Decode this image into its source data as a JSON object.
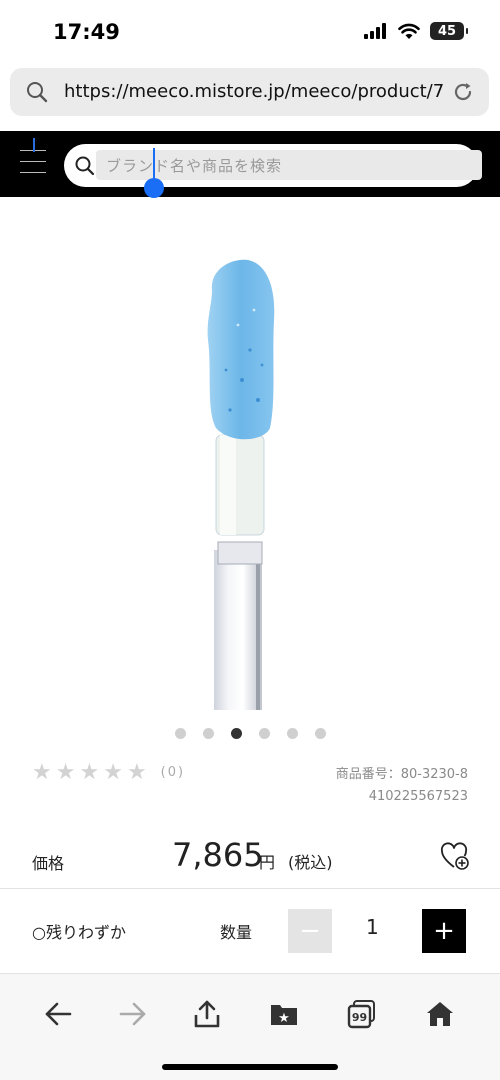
{
  "status_bar": {
    "time": "17:49",
    "battery": "45"
  },
  "browser": {
    "url": "https://meeco.mistore.jp/meeco/product/7…"
  },
  "site_header": {
    "search_placeholder": "ブランド名や商品を検索"
  },
  "carousel": {
    "count": 6,
    "active_index": 2
  },
  "rating": {
    "stars_filled": 0,
    "stars_total": 5,
    "count_text": "(0)"
  },
  "product": {
    "sku_text": "商品番号：80-3230-8410225567523",
    "price_label": "価格",
    "price": "7,865",
    "price_unit": "円",
    "price_tax": "(税込)",
    "stock": "○残りわずか",
    "quantity_label": "数量",
    "quantity": "1",
    "minus_label": "−",
    "plus_label": "+"
  },
  "colors": {
    "accent": "#1a6ef5",
    "header_bg": "#000000",
    "product_blue": "#7ec3ee"
  },
  "toolbar": {
    "icons": [
      "back-icon",
      "forward-icon",
      "share-icon",
      "bookmarks-icon",
      "tabs-icon",
      "home-icon"
    ],
    "tabs_count": "99"
  }
}
